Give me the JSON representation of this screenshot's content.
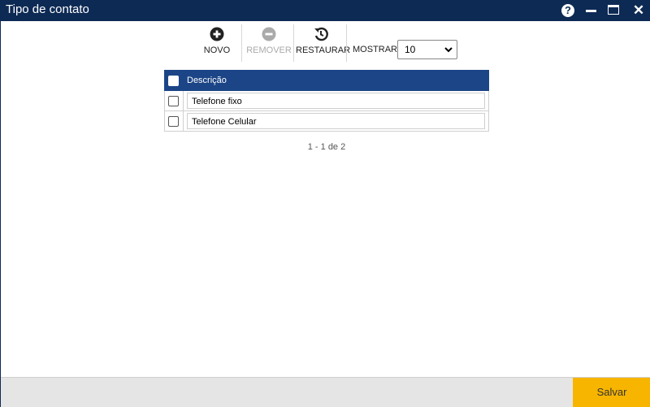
{
  "window": {
    "title": "Tipo de contato",
    "help_glyph": "?",
    "close_glyph": "✕"
  },
  "toolbar": {
    "new_label": "NOVO",
    "remove_label": "REMOVER",
    "restore_label": "RESTAURAR",
    "show_label": "MOSTRAR:",
    "page_size": "10",
    "chevron_glyph": "⌄",
    "icons": {
      "new": "plus-circle-icon",
      "remove": "minus-circle-icon",
      "restore": "history-icon"
    }
  },
  "grid": {
    "column_header": "Descrição",
    "rows": [
      {
        "description": "Telefone fixo"
      },
      {
        "description": "Telefone Celular"
      }
    ],
    "pagination": "1 - 1 de 2"
  },
  "footer": {
    "save_label": "Salvar"
  },
  "colors": {
    "titlebar": "#0d2a54",
    "grid_header": "#1c4587",
    "save_button": "#f7b500",
    "footer": "#e5e5e5"
  }
}
